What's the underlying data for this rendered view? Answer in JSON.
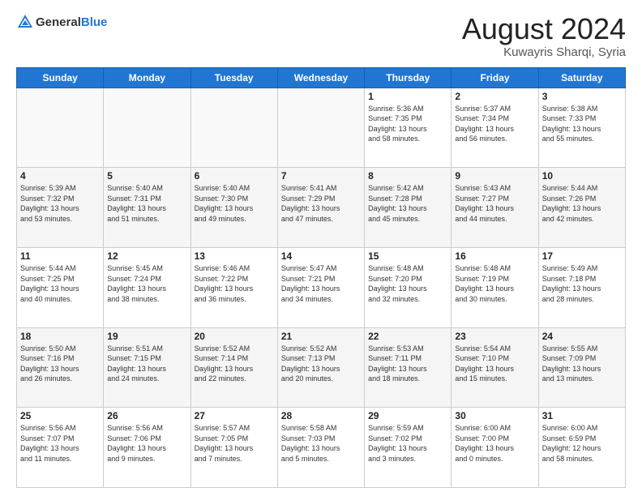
{
  "header": {
    "logo_general": "General",
    "logo_blue": "Blue",
    "month_year": "August 2024",
    "location": "Kuwayris Sharqi, Syria"
  },
  "days_of_week": [
    "Sunday",
    "Monday",
    "Tuesday",
    "Wednesday",
    "Thursday",
    "Friday",
    "Saturday"
  ],
  "weeks": [
    [
      {
        "day": "",
        "info": ""
      },
      {
        "day": "",
        "info": ""
      },
      {
        "day": "",
        "info": ""
      },
      {
        "day": "",
        "info": ""
      },
      {
        "day": "1",
        "info": "Sunrise: 5:36 AM\nSunset: 7:35 PM\nDaylight: 13 hours\nand 58 minutes."
      },
      {
        "day": "2",
        "info": "Sunrise: 5:37 AM\nSunset: 7:34 PM\nDaylight: 13 hours\nand 56 minutes."
      },
      {
        "day": "3",
        "info": "Sunrise: 5:38 AM\nSunset: 7:33 PM\nDaylight: 13 hours\nand 55 minutes."
      }
    ],
    [
      {
        "day": "4",
        "info": "Sunrise: 5:39 AM\nSunset: 7:32 PM\nDaylight: 13 hours\nand 53 minutes."
      },
      {
        "day": "5",
        "info": "Sunrise: 5:40 AM\nSunset: 7:31 PM\nDaylight: 13 hours\nand 51 minutes."
      },
      {
        "day": "6",
        "info": "Sunrise: 5:40 AM\nSunset: 7:30 PM\nDaylight: 13 hours\nand 49 minutes."
      },
      {
        "day": "7",
        "info": "Sunrise: 5:41 AM\nSunset: 7:29 PM\nDaylight: 13 hours\nand 47 minutes."
      },
      {
        "day": "8",
        "info": "Sunrise: 5:42 AM\nSunset: 7:28 PM\nDaylight: 13 hours\nand 45 minutes."
      },
      {
        "day": "9",
        "info": "Sunrise: 5:43 AM\nSunset: 7:27 PM\nDaylight: 13 hours\nand 44 minutes."
      },
      {
        "day": "10",
        "info": "Sunrise: 5:44 AM\nSunset: 7:26 PM\nDaylight: 13 hours\nand 42 minutes."
      }
    ],
    [
      {
        "day": "11",
        "info": "Sunrise: 5:44 AM\nSunset: 7:25 PM\nDaylight: 13 hours\nand 40 minutes."
      },
      {
        "day": "12",
        "info": "Sunrise: 5:45 AM\nSunset: 7:24 PM\nDaylight: 13 hours\nand 38 minutes."
      },
      {
        "day": "13",
        "info": "Sunrise: 5:46 AM\nSunset: 7:22 PM\nDaylight: 13 hours\nand 36 minutes."
      },
      {
        "day": "14",
        "info": "Sunrise: 5:47 AM\nSunset: 7:21 PM\nDaylight: 13 hours\nand 34 minutes."
      },
      {
        "day": "15",
        "info": "Sunrise: 5:48 AM\nSunset: 7:20 PM\nDaylight: 13 hours\nand 32 minutes."
      },
      {
        "day": "16",
        "info": "Sunrise: 5:48 AM\nSunset: 7:19 PM\nDaylight: 13 hours\nand 30 minutes."
      },
      {
        "day": "17",
        "info": "Sunrise: 5:49 AM\nSunset: 7:18 PM\nDaylight: 13 hours\nand 28 minutes."
      }
    ],
    [
      {
        "day": "18",
        "info": "Sunrise: 5:50 AM\nSunset: 7:16 PM\nDaylight: 13 hours\nand 26 minutes."
      },
      {
        "day": "19",
        "info": "Sunrise: 5:51 AM\nSunset: 7:15 PM\nDaylight: 13 hours\nand 24 minutes."
      },
      {
        "day": "20",
        "info": "Sunrise: 5:52 AM\nSunset: 7:14 PM\nDaylight: 13 hours\nand 22 minutes."
      },
      {
        "day": "21",
        "info": "Sunrise: 5:52 AM\nSunset: 7:13 PM\nDaylight: 13 hours\nand 20 minutes."
      },
      {
        "day": "22",
        "info": "Sunrise: 5:53 AM\nSunset: 7:11 PM\nDaylight: 13 hours\nand 18 minutes."
      },
      {
        "day": "23",
        "info": "Sunrise: 5:54 AM\nSunset: 7:10 PM\nDaylight: 13 hours\nand 15 minutes."
      },
      {
        "day": "24",
        "info": "Sunrise: 5:55 AM\nSunset: 7:09 PM\nDaylight: 13 hours\nand 13 minutes."
      }
    ],
    [
      {
        "day": "25",
        "info": "Sunrise: 5:56 AM\nSunset: 7:07 PM\nDaylight: 13 hours\nand 11 minutes."
      },
      {
        "day": "26",
        "info": "Sunrise: 5:56 AM\nSunset: 7:06 PM\nDaylight: 13 hours\nand 9 minutes."
      },
      {
        "day": "27",
        "info": "Sunrise: 5:57 AM\nSunset: 7:05 PM\nDaylight: 13 hours\nand 7 minutes."
      },
      {
        "day": "28",
        "info": "Sunrise: 5:58 AM\nSunset: 7:03 PM\nDaylight: 13 hours\nand 5 minutes."
      },
      {
        "day": "29",
        "info": "Sunrise: 5:59 AM\nSunset: 7:02 PM\nDaylight: 13 hours\nand 3 minutes."
      },
      {
        "day": "30",
        "info": "Sunrise: 6:00 AM\nSunset: 7:00 PM\nDaylight: 13 hours\nand 0 minutes."
      },
      {
        "day": "31",
        "info": "Sunrise: 6:00 AM\nSunset: 6:59 PM\nDaylight: 12 hours\nand 58 minutes."
      }
    ]
  ]
}
